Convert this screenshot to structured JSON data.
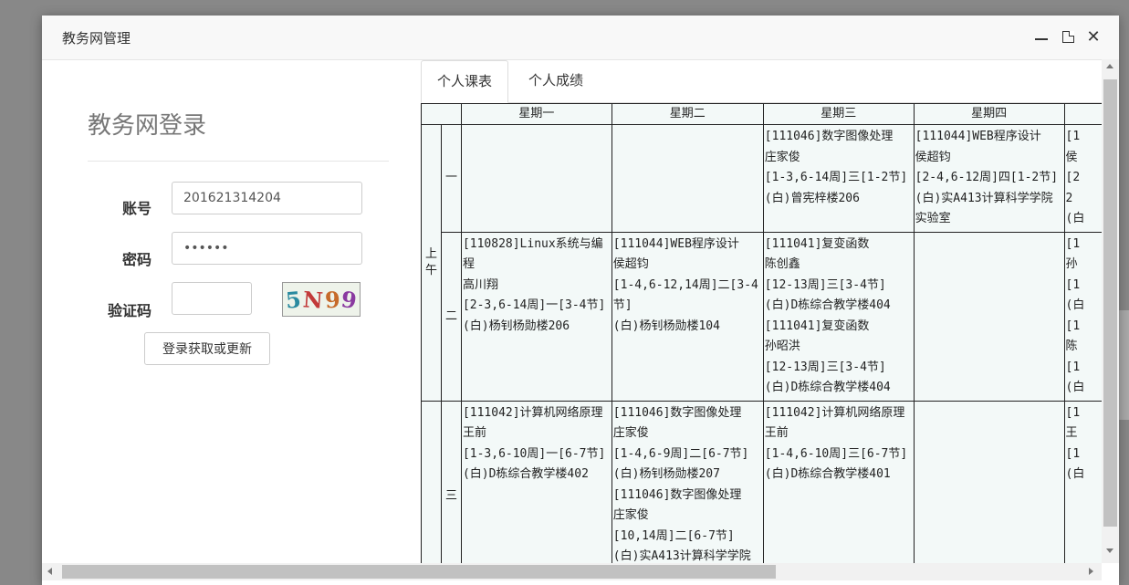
{
  "window": {
    "title": "教务网管理"
  },
  "login": {
    "heading": "教务网登录",
    "account_label": "账号",
    "account_value": "201621314204",
    "password_label": "密码",
    "password_value": "••••••",
    "captcha_label": "验证码",
    "captcha_value": "",
    "captcha_image_text": "5N99",
    "submit_label": "登录获取或更新"
  },
  "tabs": [
    {
      "label": "个人课表",
      "active": true
    },
    {
      "label": "个人成绩",
      "active": false
    }
  ],
  "timetable": {
    "days": [
      "星期一",
      "星期二",
      "星期三",
      "星期四"
    ],
    "period_label": "上午",
    "sessions": [
      "一",
      "二",
      "三"
    ],
    "cells": {
      "s1": [
        [],
        [],
        [
          "[111046]数字图像处理",
          "庄家俊",
          "[1-3,6-14周]三[1-2节]",
          "(白)曾宪梓楼206"
        ],
        [
          "[111044]WEB程序设计",
          "侯超钧",
          "[2-4,6-12周]四[1-2节]",
          "(白)实A413计算科学学院",
          "实验室"
        ],
        [
          "[1",
          "侯",
          "[2",
          "2",
          "(白"
        ]
      ],
      "s2": [
        [
          "[110828]Linux系统与编",
          "程",
          "高川翔",
          "[2-3,6-14周]一[3-4节]",
          "(白)杨钊杨勋楼206"
        ],
        [
          "[111044]WEB程序设计",
          "侯超钧",
          "[1-4,6-12,14周]二[3-4",
          "节]",
          "(白)杨钊杨勋楼104"
        ],
        [
          "[111041]复变函数",
          "陈创鑫",
          "[12-13周]三[3-4节]",
          "(白)D栋综合教学楼404",
          "[111041]复变函数",
          "孙昭洪",
          "[12-13周]三[3-4节]",
          "(白)D栋综合教学楼404"
        ],
        [],
        [
          "[1",
          "孙",
          "[1",
          "(白",
          "[1",
          "陈",
          "[1",
          "(白"
        ]
      ],
      "s3": [
        [
          "[111042]计算机网络原理",
          "王前",
          "[1-3,6-10周]一[6-7节]",
          "(白)D栋综合教学楼402"
        ],
        [
          "[111046]数字图像处理",
          "庄家俊",
          "[1-4,6-9周]二[6-7节]",
          "(白)杨钊杨勋楼207",
          "[111046]数字图像处理",
          "庄家俊",
          "[10,14周]二[6-7节]",
          "(白)实A413计算科学学院"
        ],
        [
          "[111042]计算机网络原理",
          "王前",
          "[1-4,6-10周]三[6-7节]",
          "(白)D栋综合教学楼401"
        ],
        [],
        [
          "[1",
          "王",
          "[1",
          "(白"
        ]
      ]
    }
  },
  "icons": {
    "minimize": "minimize-icon",
    "maximize": "maximize-icon",
    "close": "close-icon"
  }
}
